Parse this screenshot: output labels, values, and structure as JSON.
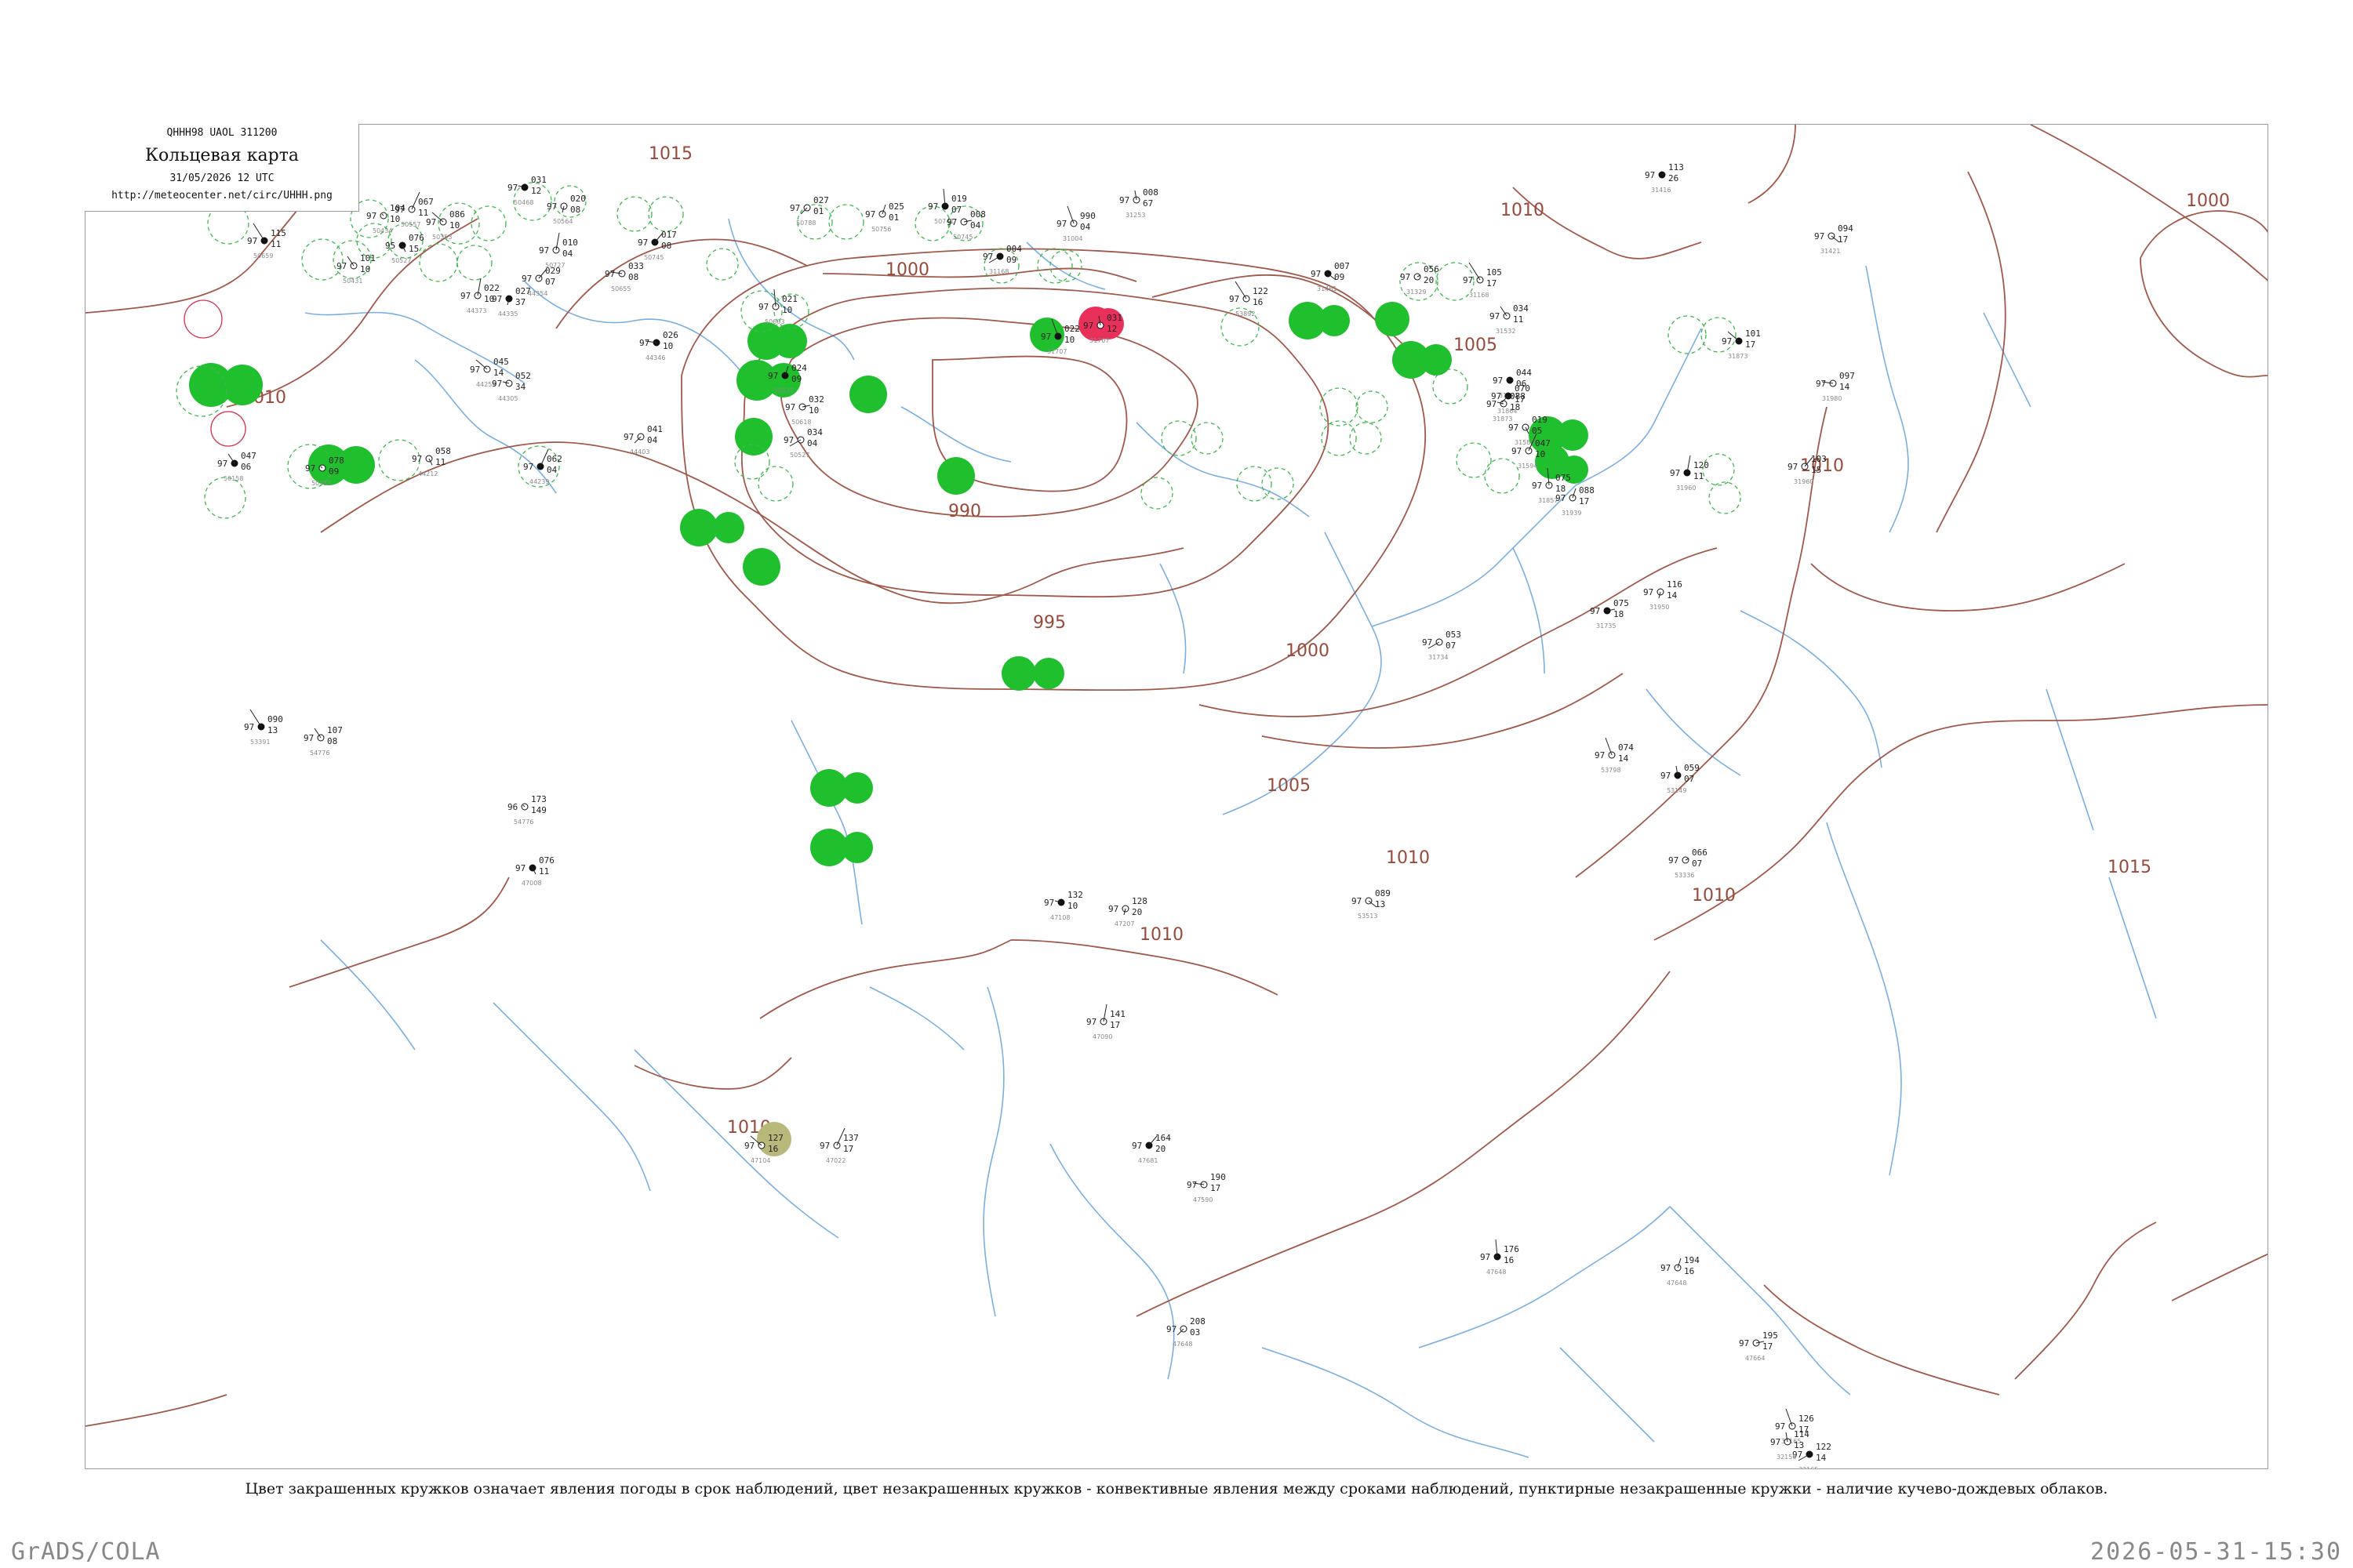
{
  "header": {
    "code": "QHHH98  UAOL  311200",
    "title": "Кольцевая карта",
    "date": "31/05/2026 12 UTC",
    "url": "http://meteocenter.net/circ/UHHH.png"
  },
  "caption": "Цвет закрашенных кружков означает явления погоды в срок наблюдений, цвет незакрашенных кружков - конвективные явления между сроками наблюдений, пунктирные незакрашенные кружки - наличие кучево-дождевых облаков.",
  "footer": {
    "left": "GrADS/COLA",
    "right": "2026-05-31-15:30"
  },
  "colors": {
    "isobar": "#a0594a",
    "water": "#7ab0e0",
    "filled_rain": "#1fbf2e",
    "filled_thunder": "#e8305a",
    "filled_fog": "#b8b87a",
    "cb_dashed": "#3fb84f",
    "convective_red": "#d83050"
  },
  "isobar_labels": [
    {
      "text": "1000"
    },
    {
      "text": "1010"
    },
    {
      "text": "1015"
    },
    {
      "text": "1005"
    },
    {
      "text": "990"
    },
    {
      "text": "995"
    },
    {
      "text": "1000"
    },
    {
      "text": "1005"
    },
    {
      "text": "1010"
    },
    {
      "text": "1010"
    },
    {
      "text": "1010"
    },
    {
      "text": "1010"
    },
    {
      "text": "1015"
    },
    {
      "text": "1000"
    },
    {
      "text": "1010"
    },
    {
      "text": "1010"
    }
  ],
  "stations": [
    {
      "t": "115",
      "p": "97",
      "d": "11",
      "id": "50659",
      "kind": "rain"
    },
    {
      "t": "101",
      "p": "97",
      "d": "10",
      "id": "50431",
      "kind": "cb"
    },
    {
      "t": "104",
      "p": "97",
      "d": "10",
      "id": "50434",
      "kind": "cb"
    },
    {
      "t": "076",
      "p": "95",
      "d": "15",
      "id": "50527",
      "kind": "cb"
    },
    {
      "t": "067",
      "p": "97",
      "d": "11",
      "id": "50557",
      "kind": "cb"
    },
    {
      "t": "086",
      "p": "97",
      "d": "10",
      "id": "50353",
      "kind": "cb"
    },
    {
      "t": "031",
      "p": "97",
      "d": "12",
      "id": "50468",
      "kind": "cb"
    },
    {
      "t": "020",
      "p": "97",
      "d": "08",
      "id": "50564",
      "kind": "cb"
    },
    {
      "t": "010",
      "p": "97",
      "d": "04",
      "id": "50727",
      "kind": "cb"
    },
    {
      "t": "017",
      "p": "97",
      "d": "08",
      "id": "50745",
      "kind": "none"
    },
    {
      "t": "033",
      "p": "97",
      "d": "08",
      "id": "50655",
      "kind": "cb"
    },
    {
      "t": "027",
      "p": "97",
      "d": "01",
      "id": "50788",
      "kind": "cb"
    },
    {
      "t": "019",
      "p": "97",
      "d": "07",
      "id": "50741",
      "kind": "cb"
    },
    {
      "t": "025",
      "p": "97",
      "d": "01",
      "id": "50756",
      "kind": "none"
    },
    {
      "t": "008",
      "p": "97",
      "d": "04",
      "id": "50745",
      "kind": "cb"
    },
    {
      "t": "004",
      "p": "97",
      "d": "09",
      "id": "31168",
      "kind": "cb"
    },
    {
      "t": "990",
      "p": "97",
      "d": "04",
      "id": "31004",
      "kind": "none"
    },
    {
      "t": "008",
      "p": "97",
      "d": "67",
      "id": "31253",
      "kind": "none"
    },
    {
      "t": "113",
      "p": "97",
      "d": "26",
      "id": "31416",
      "kind": "none"
    },
    {
      "t": "094",
      "p": "97",
      "d": "17",
      "id": "31421",
      "kind": "none"
    },
    {
      "t": "122",
      "p": "97",
      "d": "16",
      "id": "53892",
      "kind": "cb"
    },
    {
      "t": "047",
      "p": "97",
      "d": "06",
      "id": "50158",
      "kind": "cb"
    },
    {
      "t": "078",
      "p": "97",
      "d": "09",
      "id": "50353",
      "kind": "cb"
    },
    {
      "t": "058",
      "p": "97",
      "d": "11",
      "id": "44212",
      "kind": "cb"
    },
    {
      "t": "062",
      "p": "97",
      "d": "04",
      "id": "44239",
      "kind": "cb"
    },
    {
      "t": "045",
      "p": "97",
      "d": "14",
      "id": "44259",
      "kind": "none"
    },
    {
      "t": "052",
      "p": "97",
      "d": "34",
      "id": "44305",
      "kind": "none"
    },
    {
      "t": "027",
      "p": "97",
      "d": "37",
      "id": "44335",
      "kind": "none"
    },
    {
      "t": "022",
      "p": "97",
      "d": "10",
      "id": "44373",
      "kind": "none"
    },
    {
      "t": "029",
      "p": "97",
      "d": "07",
      "id": "44354",
      "kind": "cb"
    },
    {
      "t": "026",
      "p": "97",
      "d": "10",
      "id": "44346",
      "kind": "cb"
    },
    {
      "t": "041",
      "p": "97",
      "d": "04",
      "id": "44403",
      "kind": "none"
    },
    {
      "t": "021",
      "p": "97",
      "d": "10",
      "id": "50603",
      "kind": "rain"
    },
    {
      "t": "024",
      "p": "97",
      "d": "09",
      "id": "50527",
      "kind": "rain"
    },
    {
      "t": "032",
      "p": "97",
      "d": "10",
      "id": "50618",
      "kind": "rain"
    },
    {
      "t": "034",
      "p": "97",
      "d": "04",
      "id": "50527",
      "kind": "rain"
    },
    {
      "t": "022",
      "p": "97",
      "d": "10",
      "id": "31707",
      "kind": "rain"
    },
    {
      "t": "031",
      "p": "97",
      "d": "12",
      "id": "31707",
      "kind": "thunder"
    },
    {
      "t": "056",
      "p": "97",
      "d": "20",
      "id": "31329",
      "kind": "cb"
    },
    {
      "t": "007",
      "p": "97",
      "d": "09",
      "id": "31461",
      "kind": "cb"
    },
    {
      "t": "105",
      "p": "97",
      "d": "17",
      "id": "31168",
      "kind": "none"
    },
    {
      "t": "034",
      "p": "97",
      "d": "11",
      "id": "31532",
      "kind": "rain"
    },
    {
      "t": "044",
      "p": "97",
      "d": "06",
      "id": "31532",
      "kind": "rain"
    },
    {
      "t": "019",
      "p": "97",
      "d": "05",
      "id": "31583",
      "kind": "rain"
    },
    {
      "t": "047",
      "p": "97",
      "d": "10",
      "id": "31594",
      "kind": "rain"
    },
    {
      "t": "101",
      "p": "97",
      "d": "17",
      "id": "31873",
      "kind": "cb"
    },
    {
      "t": "088",
      "p": "97",
      "d": "18",
      "id": "31873",
      "kind": "none"
    },
    {
      "t": "116",
      "p": "97",
      "d": "14",
      "id": "31950",
      "kind": "rain"
    },
    {
      "t": "120",
      "p": "97",
      "d": "11",
      "id": "31960",
      "kind": "rain"
    },
    {
      "t": "103",
      "p": "97",
      "d": "15",
      "id": "31960",
      "kind": "none"
    },
    {
      "t": "097",
      "p": "97",
      "d": "14",
      "id": "31980",
      "kind": "none"
    },
    {
      "t": "070",
      "p": "97",
      "d": "17",
      "id": "31864",
      "kind": "none"
    },
    {
      "t": "075",
      "p": "97",
      "d": "18",
      "id": "31857",
      "kind": "none"
    },
    {
      "t": "088",
      "p": "97",
      "d": "17",
      "id": "31939",
      "kind": "none"
    },
    {
      "t": "075",
      "p": "97",
      "d": "18",
      "id": "31735",
      "kind": "none"
    },
    {
      "t": "053",
      "p": "97",
      "d": "07",
      "id": "31734",
      "kind": "none"
    },
    {
      "t": "074",
      "p": "97",
      "d": "14",
      "id": "53798",
      "kind": "none"
    },
    {
      "t": "059",
      "p": "97",
      "d": "07",
      "id": "53149",
      "kind": "none"
    },
    {
      "t": "066",
      "p": "97",
      "d": "07",
      "id": "53336",
      "kind": "none"
    },
    {
      "t": "089",
      "p": "97",
      "d": "13",
      "id": "53513",
      "kind": "none"
    },
    {
      "t": "090",
      "p": "97",
      "d": "13",
      "id": "53391",
      "kind": "none"
    },
    {
      "t": "107",
      "p": "97",
      "d": "08",
      "id": "54776",
      "kind": "fog"
    },
    {
      "t": "173",
      "p": "96",
      "d": "149",
      "id": "54776",
      "kind": "fog"
    },
    {
      "t": "076",
      "p": "97",
      "d": "11",
      "id": "47008",
      "kind": "none"
    },
    {
      "t": "137",
      "p": "97",
      "d": "17",
      "id": "47022",
      "kind": "none"
    },
    {
      "t": "127",
      "p": "97",
      "d": "16",
      "id": "47104",
      "kind": "none"
    },
    {
      "t": "132",
      "p": "97",
      "d": "10",
      "id": "47108",
      "kind": "none"
    },
    {
      "t": "128",
      "p": "97",
      "d": "20",
      "id": "47207",
      "kind": "none"
    },
    {
      "t": "141",
      "p": "97",
      "d": "17",
      "id": "47090",
      "kind": "none"
    },
    {
      "t": "164",
      "p": "97",
      "d": "20",
      "id": "47681",
      "kind": "none"
    },
    {
      "t": "190",
      "p": "97",
      "d": "17",
      "id": "47590",
      "kind": "none"
    },
    {
      "t": "208",
      "p": "97",
      "d": "03",
      "id": "47648",
      "kind": "none"
    },
    {
      "t": "176",
      "p": "97",
      "d": "16",
      "id": "47648",
      "kind": "none"
    },
    {
      "t": "194",
      "p": "97",
      "d": "16",
      "id": "47648",
      "kind": "none"
    },
    {
      "t": "195",
      "p": "97",
      "d": "17",
      "id": "47664",
      "kind": "none"
    },
    {
      "t": "122",
      "p": "97",
      "d": "14",
      "id": "32165",
      "kind": "none"
    },
    {
      "t": "126",
      "p": "97",
      "d": "17",
      "id": "32165",
      "kind": "none"
    },
    {
      "t": "114",
      "p": "97",
      "d": "13",
      "id": "32150",
      "kind": "none"
    }
  ]
}
